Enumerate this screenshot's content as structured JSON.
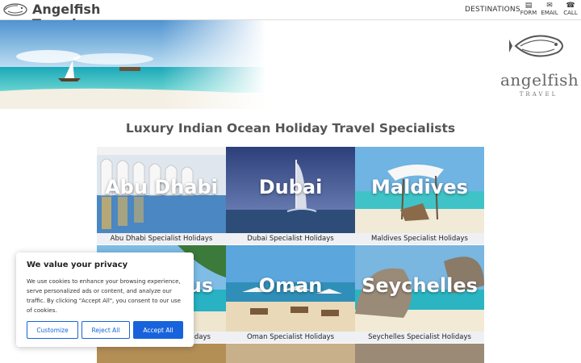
{
  "header": {
    "brand": "Angelfish Travel",
    "nav_destinations": "DESTINATIONS",
    "nav_items": [
      {
        "label": "FORM",
        "icon": "form-icon",
        "glyph": "▤"
      },
      {
        "label": "EMAIL",
        "icon": "email-icon",
        "glyph": "✉"
      },
      {
        "label": "CALL",
        "icon": "phone-icon",
        "glyph": "☎"
      }
    ]
  },
  "hero": {
    "logo_word": "angelfish",
    "logo_sub": "TRAVEL"
  },
  "headline": "Luxury Indian Ocean Holiday Travel Specialists",
  "destinations": [
    {
      "name": "Abu Dhabi",
      "caption": "Abu Dhabi Specialist Holidays"
    },
    {
      "name": "Dubai",
      "caption": "Dubai Specialist Holidays"
    },
    {
      "name": "Maldives",
      "caption": "Maldives Specialist Holidays"
    },
    {
      "name": "Mauritius",
      "caption": "Mauritius Specialist Holidays"
    },
    {
      "name": "Oman",
      "caption": "Oman Specialist Holidays"
    },
    {
      "name": "Seychelles",
      "caption": "Seychelles Specialist Holidays"
    }
  ],
  "cookie": {
    "title": "We value your privacy",
    "body": "We use cookies to enhance your browsing experience, serve personalized ads or content, and analyze our traffic. By clicking \"Accept All\", you consent to our use of cookies.",
    "customize": "Customize",
    "reject": "Reject All",
    "accept": "Accept All"
  },
  "colors": {
    "accent": "#1863dc",
    "text": "#444444",
    "caption_bg": "#eef0f4"
  }
}
